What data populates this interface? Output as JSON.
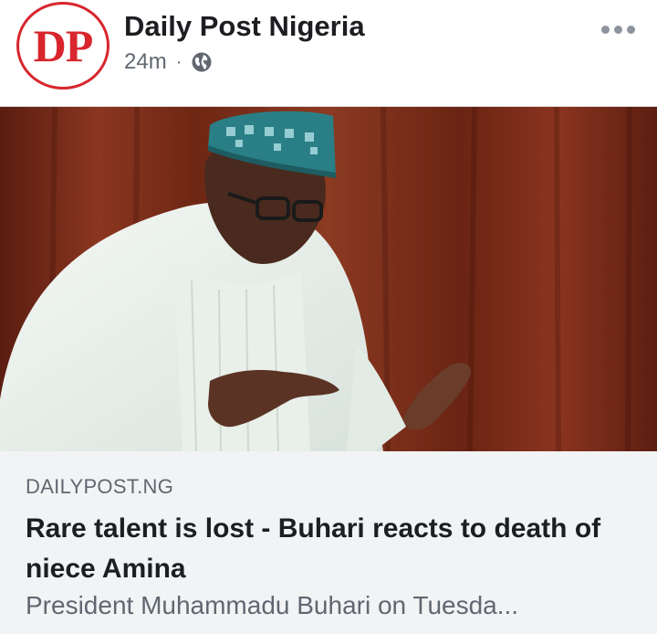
{
  "post": {
    "page_name": "Daily Post Nigeria",
    "avatar_text": "DP",
    "timestamp": "24m",
    "separator": "·",
    "audience_icon": "globe-icon",
    "more_icon": "more-options-icon"
  },
  "image": {
    "description_icon": "news-photo"
  },
  "link": {
    "domain": "DAILYPOST.NG",
    "headline": "Rare talent is lost - Buhari reacts to death of niece Amina",
    "snippet": "President Muhammadu Buhari on Tuesda..."
  },
  "colors": {
    "brand_red": "#d8262c",
    "card_bg": "#f2f3f5",
    "curtain": "#7a2a18"
  }
}
